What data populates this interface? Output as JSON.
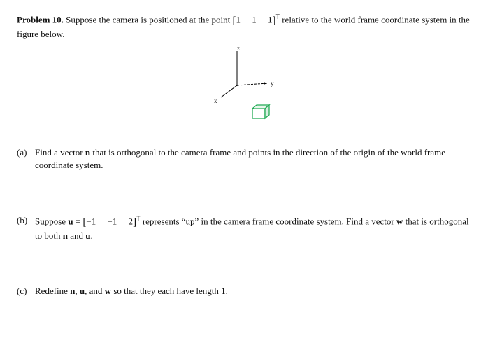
{
  "problem": {
    "label": "Problem 10.",
    "intro_a": "Suppose the camera is positioned at the point ",
    "vec_open": "[",
    "vec_vals": "1  1  1",
    "vec_close": "]",
    "sup_T": "T",
    "intro_b": " relative to the world frame coordinate system in the figure below."
  },
  "figure": {
    "z": "z",
    "y": "y",
    "x": "x"
  },
  "parts": {
    "a": {
      "label": "(a)",
      "text_1": "Find a vector ",
      "n": "n",
      "text_2": " that is orthogonal to the camera frame and points in the direction of the origin of the world frame coordinate system."
    },
    "b": {
      "label": "(b)",
      "text_1": "Suppose ",
      "u": "u",
      "eq": " = ",
      "vec_open": "[",
      "vec_vals": "−1  −1  2",
      "vec_close": "]",
      "sup_T": "T",
      "text_2": " represents “up” in the camera frame coordinate system. Find a vector ",
      "w": "w",
      "text_3": " that is orthogonal to both ",
      "n2": "n",
      "and": " and ",
      "u2": "u",
      "period": "."
    },
    "c": {
      "label": "(c)",
      "text_1": "Redefine ",
      "n": "n",
      "c1": ", ",
      "u": "u",
      "c2": ", and ",
      "w": "w",
      "text_2": " so that they each have length 1."
    }
  }
}
